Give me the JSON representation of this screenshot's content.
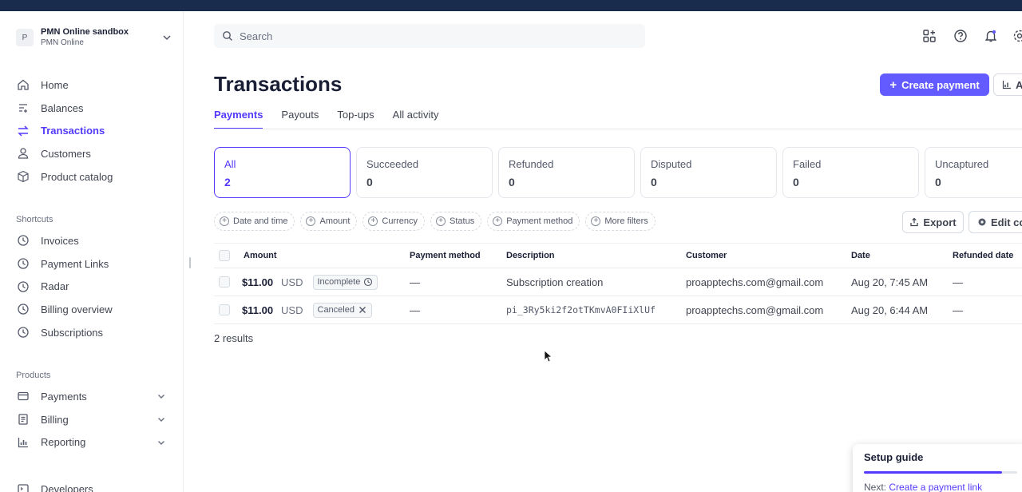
{
  "account": {
    "avatar_letter": "P",
    "name": "PMN Online sandbox",
    "subtitle": "PMN Online"
  },
  "sidebar": {
    "main_items": [
      {
        "label": "Home",
        "icon": "home-icon"
      },
      {
        "label": "Balances",
        "icon": "balances-icon"
      },
      {
        "label": "Transactions",
        "icon": "transactions-icon",
        "active": true
      },
      {
        "label": "Customers",
        "icon": "person-icon"
      },
      {
        "label": "Product catalog",
        "icon": "box-icon"
      }
    ],
    "shortcuts_label": "Shortcuts",
    "shortcuts": [
      {
        "label": "Invoices",
        "icon": "clock-icon"
      },
      {
        "label": "Payment Links",
        "icon": "clock-icon"
      },
      {
        "label": "Radar",
        "icon": "clock-icon"
      },
      {
        "label": "Billing overview",
        "icon": "clock-icon"
      },
      {
        "label": "Subscriptions",
        "icon": "clock-icon"
      }
    ],
    "products_label": "Products",
    "products": [
      {
        "label": "Payments",
        "icon": "card-icon"
      },
      {
        "label": "Billing",
        "icon": "billing-icon"
      },
      {
        "label": "Reporting",
        "icon": "chart-icon"
      }
    ],
    "developers_label": "Developers"
  },
  "search": {
    "placeholder": "Search"
  },
  "header_icons": [
    "apps-icon",
    "help-icon",
    "bell-icon",
    "settings-icon"
  ],
  "page": {
    "title": "Transactions",
    "create_button": "Create payment",
    "analyze_button": "A"
  },
  "tabs": [
    {
      "label": "Payments",
      "active": true
    },
    {
      "label": "Payouts"
    },
    {
      "label": "Top-ups"
    },
    {
      "label": "All activity"
    }
  ],
  "status_cards": [
    {
      "label": "All",
      "count": "2",
      "active": true
    },
    {
      "label": "Succeeded",
      "count": "0"
    },
    {
      "label": "Refunded",
      "count": "0"
    },
    {
      "label": "Disputed",
      "count": "0"
    },
    {
      "label": "Failed",
      "count": "0"
    },
    {
      "label": "Uncaptured",
      "count": "0"
    }
  ],
  "filters": [
    "Date and time",
    "Amount",
    "Currency",
    "Status",
    "Payment method",
    "More filters"
  ],
  "toolbar": {
    "export_label": "Export",
    "edit_columns_label": "Edit co"
  },
  "table": {
    "columns": [
      "Amount",
      "Payment method",
      "Description",
      "Customer",
      "Date",
      "Refunded date"
    ],
    "rows": [
      {
        "amount": "$11.00",
        "currency": "USD",
        "status": "Incomplete",
        "status_icon": "clock-icon",
        "payment_method": "—",
        "description": "Subscription creation",
        "customer": "proapptechs.com@gmail.com",
        "date": "Aug 20, 7:45 AM",
        "refunded_date": "—"
      },
      {
        "amount": "$11.00",
        "currency": "USD",
        "status": "Canceled",
        "status_icon": "x-icon",
        "payment_method": "—",
        "description": "pi_3Ry5ki2f2otTKmvA0FIiXlUf",
        "customer": "proapptechs.com@gmail.com",
        "date": "Aug 20, 6:44 AM",
        "refunded_date": "—"
      }
    ],
    "results_text": "2 results"
  },
  "setup_guide": {
    "title": "Setup guide",
    "progress": 0.9,
    "next_prefix": "Next: ",
    "next_link": "Create a payment link"
  },
  "colors": {
    "accent": "#533afd",
    "button": "#635bff",
    "topbar": "#1a2c4e"
  }
}
